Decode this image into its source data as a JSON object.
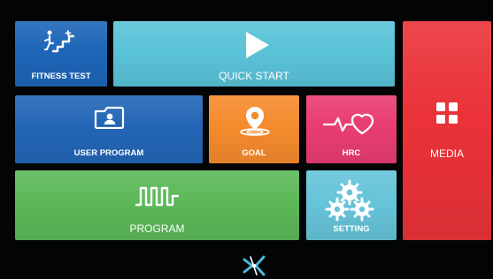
{
  "tiles": {
    "fitness_test": {
      "label": "FITNESS TEST",
      "icon": "fitness-test-icon",
      "color": "#1e66b8"
    },
    "quick_start": {
      "label": "QUICK START",
      "icon": "play-icon",
      "color": "#5ac3d8"
    },
    "media": {
      "label": "MEDIA",
      "icon": "media-grid-icon",
      "color": "#ea3238"
    },
    "user_program": {
      "label": "USER PROGRAM",
      "icon": "user-folder-icon",
      "color": "#2366b6"
    },
    "goal": {
      "label": "GOAL",
      "icon": "goal-location-icon",
      "color": "#f58b2d"
    },
    "hrc": {
      "label": "HRC",
      "icon": "heart-rate-icon",
      "color": "#e93d72"
    },
    "program": {
      "label": "PROGRAM",
      "icon": "program-profile-icon",
      "color": "#5cb958"
    },
    "setting": {
      "label": "SETTING",
      "icon": "gear-icon",
      "color": "#66c4d9"
    }
  },
  "footer": {
    "logo_icon": "brand-logo-icon"
  }
}
